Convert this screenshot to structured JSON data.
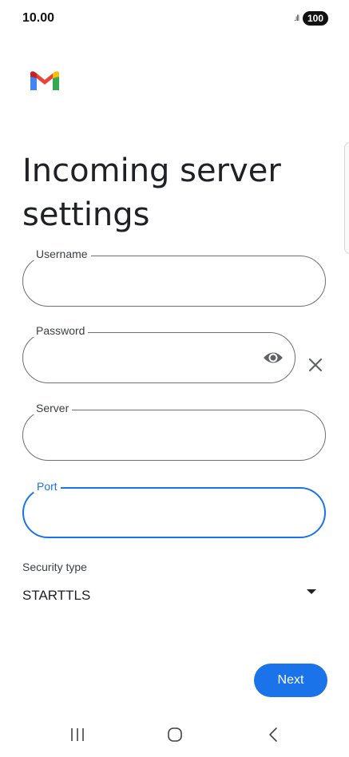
{
  "status_bar": {
    "time": "10.00",
    "signal": ".ıll",
    "battery": "100"
  },
  "app": {
    "logo": "gmail-logo"
  },
  "page": {
    "title": "Incoming server settings"
  },
  "form": {
    "username": {
      "label": "Username",
      "value": ""
    },
    "password": {
      "label": "Password",
      "value": ""
    },
    "server": {
      "label": "Server",
      "value": ""
    },
    "port": {
      "label": "Port",
      "value": ""
    },
    "security": {
      "label": "Security type",
      "selected": "STARTTLS"
    }
  },
  "actions": {
    "next_label": "Next"
  },
  "icons": {
    "reveal_password": "eye-icon",
    "clear": "close-icon",
    "dropdown": "dropdown-arrow-icon",
    "nav_recents": "recents-icon",
    "nav_home": "home-icon",
    "nav_back": "back-icon"
  },
  "colors": {
    "accent": "#1a73e8",
    "outline": "#6f6f6f",
    "text": "#202124"
  }
}
